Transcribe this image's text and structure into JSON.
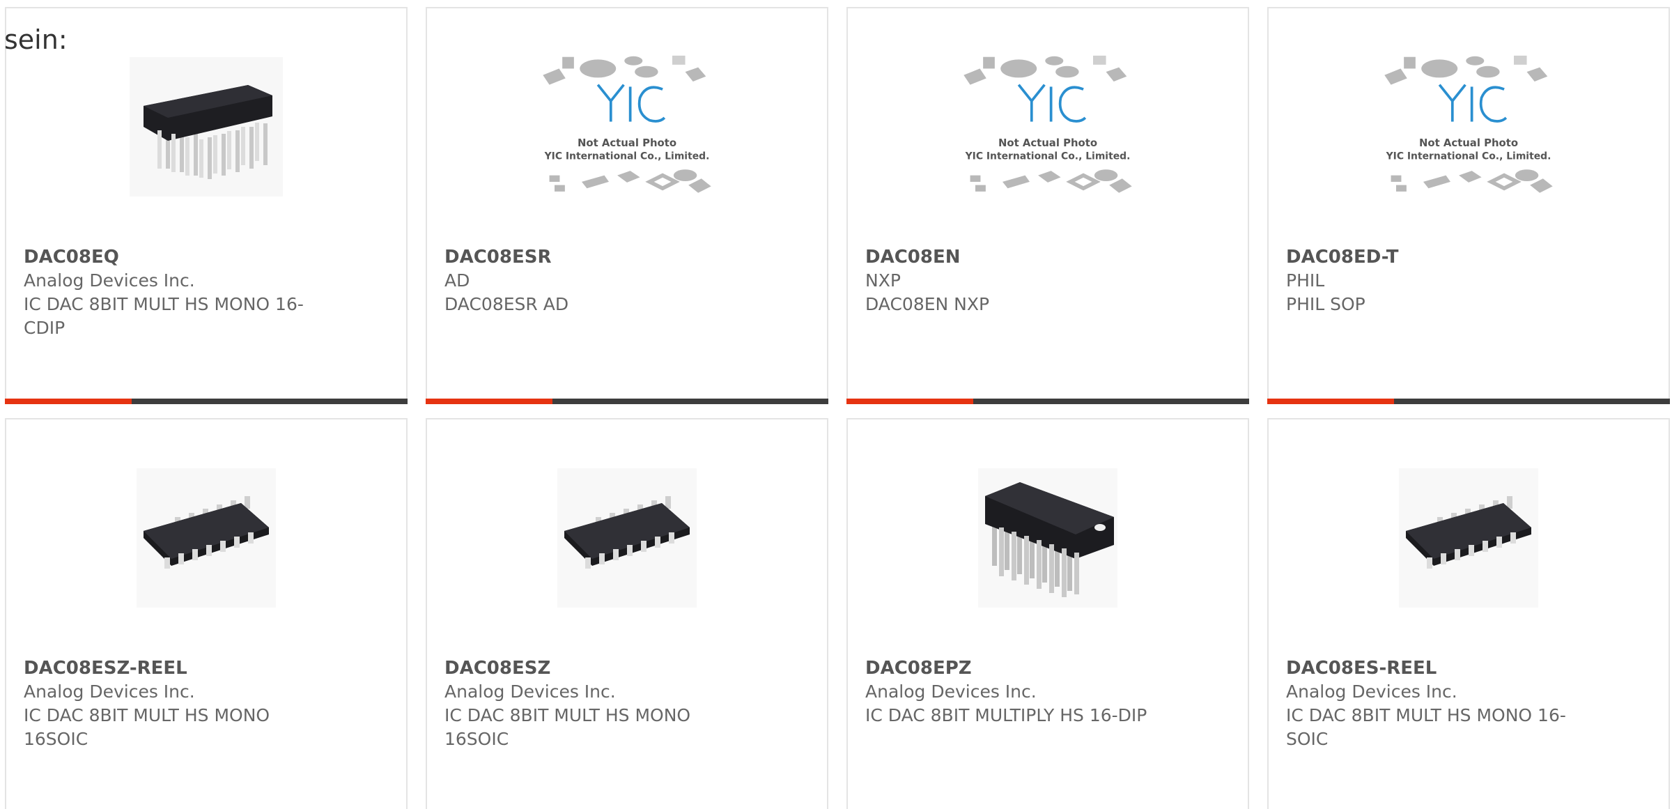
{
  "intro_text": "sein:",
  "colors": {
    "accent_bar": "#e63311",
    "base_bar": "#3d3d3d",
    "yic_logo": "#2a8fd0"
  },
  "products": [
    {
      "part_number": "DAC08EQ",
      "manufacturer": "Analog Devices Inc.",
      "description": "IC DAC 8BIT MULT HS MONO 16-CDIP",
      "image": "dip-ceramic-chip-icon"
    },
    {
      "part_number": "DAC08ESR",
      "manufacturer": "AD",
      "description": "DAC08ESR AD",
      "image": "yic-placeholder",
      "placeholder_line1": "Not Actual Photo",
      "placeholder_line2": "YIC International Co., Limited."
    },
    {
      "part_number": "DAC08EN",
      "manufacturer": "NXP",
      "description": "DAC08EN NXP",
      "image": "yic-placeholder",
      "placeholder_line1": "Not Actual Photo",
      "placeholder_line2": "YIC International Co., Limited."
    },
    {
      "part_number": "DAC08ED-T",
      "manufacturer": "PHIL",
      "description": "PHIL SOP",
      "image": "yic-placeholder",
      "placeholder_line1": "Not Actual Photo",
      "placeholder_line2": "YIC International Co., Limited."
    },
    {
      "part_number": "DAC08ESZ-REEL",
      "manufacturer": "Analog Devices Inc.",
      "description": "IC DAC 8BIT MULT HS MONO 16SOIC",
      "image": "soic-chip-icon"
    },
    {
      "part_number": "DAC08ESZ",
      "manufacturer": "Analog Devices Inc.",
      "description": "IC DAC 8BIT MULT HS MONO 16SOIC",
      "image": "soic-chip-icon"
    },
    {
      "part_number": "DAC08EPZ",
      "manufacturer": "Analog Devices Inc.",
      "description": "IC DAC 8BIT MULTIPLY HS 16-DIP",
      "image": "dip-plastic-chip-icon"
    },
    {
      "part_number": "DAC08ES-REEL",
      "manufacturer": "Analog Devices Inc.",
      "description": "IC DAC 8BIT MULT HS MONO 16-SOIC",
      "image": "soic-chip-icon"
    }
  ]
}
